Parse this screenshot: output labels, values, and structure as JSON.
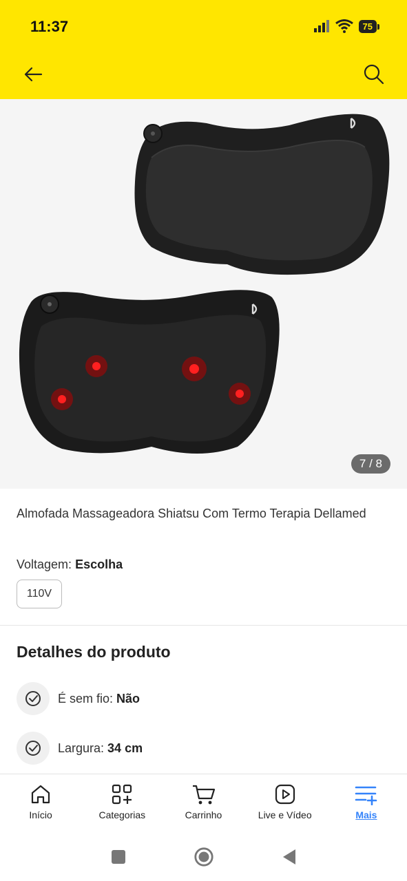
{
  "status_bar": {
    "time": "11:37",
    "battery": "75"
  },
  "gallery": {
    "counter": "7 / 8"
  },
  "product": {
    "title": "Almofada Massageadora Shiatsu Com Termo Terapia Dellamed",
    "variation_label": "Voltagem:",
    "variation_value": "Escolha",
    "option": "110V"
  },
  "details": {
    "heading": "Detalhes do produto",
    "items": [
      {
        "label": "É sem fio:",
        "value": "Não",
        "icon": "check-circle-icon"
      },
      {
        "label": "Largura:",
        "value": "34 cm",
        "icon": "check-circle-icon"
      }
    ]
  },
  "bottom_nav": [
    {
      "label": "Início",
      "icon": "home-icon"
    },
    {
      "label": "Categorias",
      "icon": "grid-plus-icon"
    },
    {
      "label": "Carrinho",
      "icon": "cart-icon"
    },
    {
      "label": "Live e Vídeo",
      "icon": "play-icon"
    },
    {
      "label": "Mais",
      "icon": "menu-plus-icon",
      "active": true
    }
  ],
  "colors": {
    "brand_yellow": "#ffe600",
    "accent_blue": "#3483fa"
  }
}
